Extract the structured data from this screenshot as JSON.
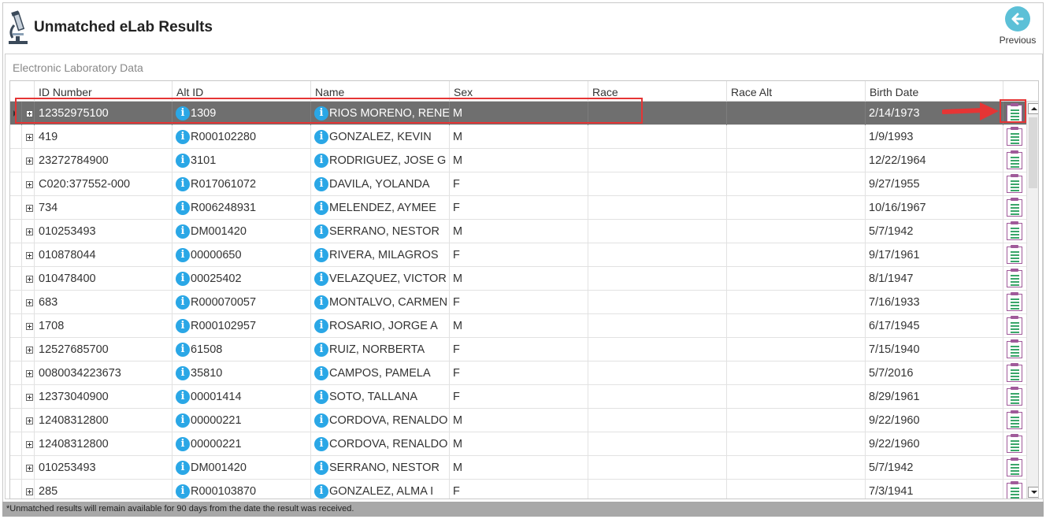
{
  "header": {
    "title": "Unmatched eLab Results",
    "previous_label": "Previous",
    "app_icon": "microscope-icon",
    "previous_icon": "arrow-left-icon"
  },
  "panel": {
    "title": "Electronic Laboratory Data"
  },
  "grid": {
    "columns": [
      "ID Number",
      "Alt ID",
      "Name",
      "Sex",
      "Race",
      "Race Alt",
      "Birth Date"
    ],
    "rows": [
      {
        "id": "12352975100",
        "alt_id": "1309",
        "name": "RIOS MORENO, RENE",
        "sex": "M",
        "race": "",
        "race_alt": "",
        "birth": "2/14/1973",
        "selected": true
      },
      {
        "id": "419",
        "alt_id": "R000102280",
        "name": "GONZALEZ, KEVIN",
        "sex": "M",
        "race": "",
        "race_alt": "",
        "birth": "1/9/1993"
      },
      {
        "id": "23272784900",
        "alt_id": "3101",
        "name": "RODRIGUEZ, JOSE G",
        "sex": "M",
        "race": "",
        "race_alt": "",
        "birth": "12/22/1964"
      },
      {
        "id": "C020:377552-000",
        "alt_id": "R017061072",
        "name": "DAVILA, YOLANDA",
        "sex": "F",
        "race": "",
        "race_alt": "",
        "birth": "9/27/1955"
      },
      {
        "id": "734",
        "alt_id": "R006248931",
        "name": "MELENDEZ, AYMEE",
        "sex": "F",
        "race": "",
        "race_alt": "",
        "birth": "10/16/1967"
      },
      {
        "id": "010253493",
        "alt_id": "DM001420",
        "name": "SERRANO, NESTOR",
        "sex": "M",
        "race": "",
        "race_alt": "",
        "birth": "5/7/1942"
      },
      {
        "id": "010878044",
        "alt_id": "00000650",
        "name": "RIVERA, MILAGROS",
        "sex": "F",
        "race": "",
        "race_alt": "",
        "birth": "9/17/1961"
      },
      {
        "id": "010478400",
        "alt_id": "00025402",
        "name": "VELAZQUEZ, VICTOR I",
        "sex": "M",
        "race": "",
        "race_alt": "",
        "birth": "8/1/1947"
      },
      {
        "id": "683",
        "alt_id": "R000070057",
        "name": "MONTALVO, CARMEN",
        "sex": "F",
        "race": "",
        "race_alt": "",
        "birth": "7/16/1933"
      },
      {
        "id": "1708",
        "alt_id": "R000102957",
        "name": "ROSARIO, JORGE A",
        "sex": "M",
        "race": "",
        "race_alt": "",
        "birth": "6/17/1945"
      },
      {
        "id": "12527685700",
        "alt_id": "61508",
        "name": "RUIZ, NORBERTA",
        "sex": "F",
        "race": "",
        "race_alt": "",
        "birth": "7/15/1940"
      },
      {
        "id": "0080034223673",
        "alt_id": "35810",
        "name": "CAMPOS, PAMELA",
        "sex": "F",
        "race": "",
        "race_alt": "",
        "birth": "5/7/2016"
      },
      {
        "id": "12373040900",
        "alt_id": "00001414",
        "name": "SOTO, TALLANA",
        "sex": "F",
        "race": "",
        "race_alt": "",
        "birth": "8/29/1961"
      },
      {
        "id": "12408312800",
        "alt_id": "00000221",
        "name": "CORDOVA, RENALDO",
        "sex": "M",
        "race": "",
        "race_alt": "",
        "birth": "9/22/1960"
      },
      {
        "id": "12408312800",
        "alt_id": "00000221",
        "name": "CORDOVA, RENALDO",
        "sex": "M",
        "race": "",
        "race_alt": "",
        "birth": "9/22/1960"
      },
      {
        "id": "010253493",
        "alt_id": "DM001420",
        "name": "SERRANO, NESTOR",
        "sex": "M",
        "race": "",
        "race_alt": "",
        "birth": "5/7/1942"
      },
      {
        "id": "285",
        "alt_id": "R000103870",
        "name": "GONZALEZ, ALMA I",
        "sex": "F",
        "race": "",
        "race_alt": "",
        "birth": "7/3/1941"
      }
    ],
    "info_icon": "info-icon",
    "doc_icon": "clipboard-report-icon"
  },
  "footer": {
    "note": "*Unmatched results will remain available for 90 days from the date the result was received."
  },
  "colors": {
    "accent": "#5cc0d7",
    "info": "#2aa7e6",
    "selected_row": "#6f6f6f",
    "annotation": "#e53535"
  }
}
